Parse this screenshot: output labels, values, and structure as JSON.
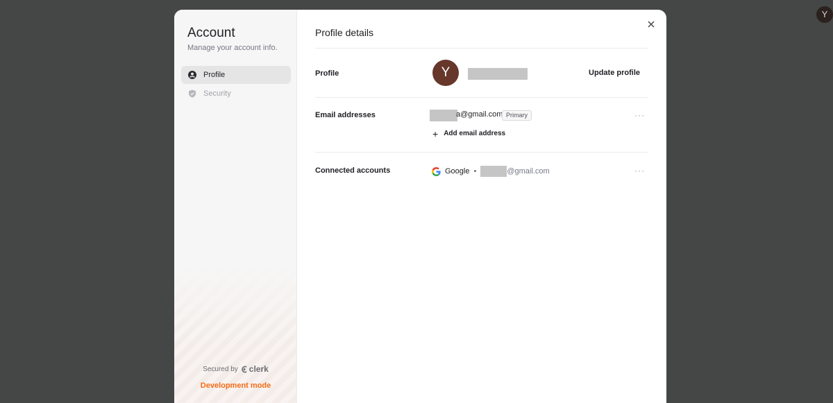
{
  "top_avatar": {
    "initial": "Y"
  },
  "sidebar": {
    "title": "Account",
    "subtitle": "Manage your account info.",
    "items": [
      {
        "label": "Profile",
        "icon": "user-circle-icon",
        "active": true
      },
      {
        "label": "Security",
        "icon": "shield-icon",
        "active": false
      }
    ],
    "secured_by": "Secured by",
    "brand": "clerk",
    "dev_mode": "Development mode"
  },
  "main": {
    "title": "Profile details",
    "profile": {
      "label": "Profile",
      "avatar_initial": "Y",
      "update_label": "Update profile"
    },
    "email": {
      "label": "Email addresses",
      "address_suffix": "a@gmail.com",
      "badge": "Primary",
      "add_label": "Add email address"
    },
    "connected": {
      "label": "Connected accounts",
      "provider": "Google",
      "separator": "•",
      "email_suffix": "@gmail.com"
    }
  },
  "colors": {
    "overlay": "#454646",
    "avatar": "#66372a",
    "dev_mode": "#f36b16"
  }
}
